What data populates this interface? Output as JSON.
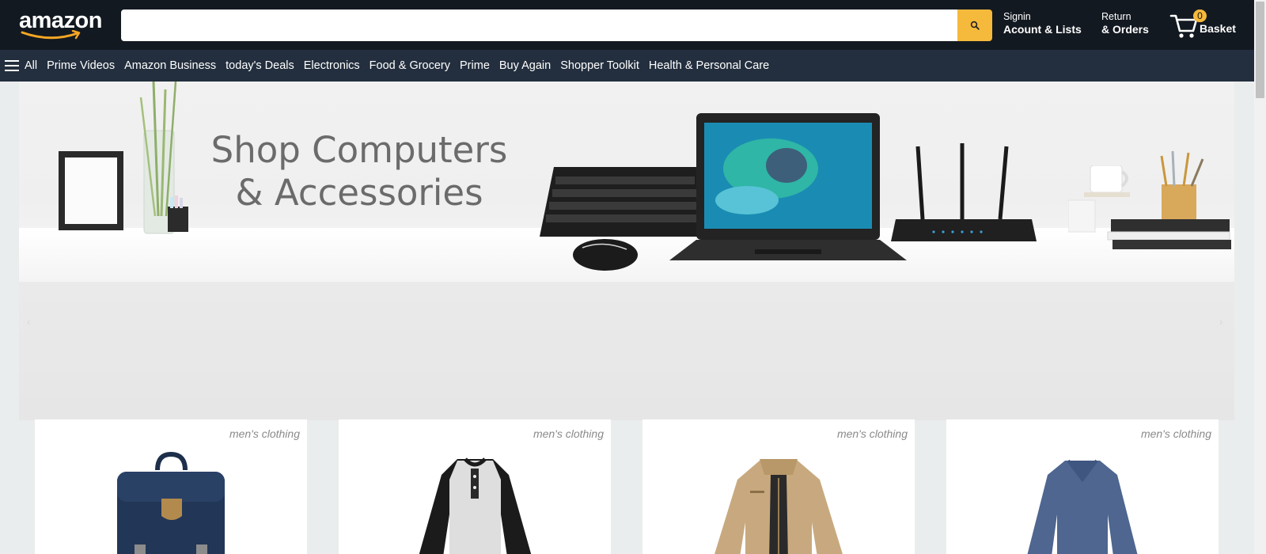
{
  "header": {
    "logo_text": "amazon",
    "search": {
      "value": "",
      "placeholder": ""
    },
    "account": {
      "line1": "Signin",
      "line2": "Acount & Lists"
    },
    "orders": {
      "line1": "Return",
      "line2": "& Orders"
    },
    "basket": {
      "count": "0",
      "label": "Basket"
    }
  },
  "nav": {
    "menu_label": "All",
    "items": [
      "Prime Videos",
      "Amazon Business",
      "today's Deals",
      "Electronics",
      "Food & Grocery",
      "Prime",
      "Buy Again",
      "Shopper Toolkit",
      "Health & Personal Care"
    ]
  },
  "hero": {
    "banner_title_line1": "Shop Computers",
    "banner_title_line2": "& Accessories",
    "prev_arrow": "‹",
    "next_arrow": "›"
  },
  "products": [
    {
      "category": "men's clothing",
      "image": "backpack"
    },
    {
      "category": "men's clothing",
      "image": "henley-raglan-shirt"
    },
    {
      "category": "men's clothing",
      "image": "cotton-jacket"
    },
    {
      "category": "men's clothing",
      "image": "slim-fit-tshirt"
    }
  ],
  "colors": {
    "header_bg": "#131921",
    "nav_bg": "#232f3e",
    "accent": "#f5b93b",
    "page_bg": "#eaeded"
  }
}
